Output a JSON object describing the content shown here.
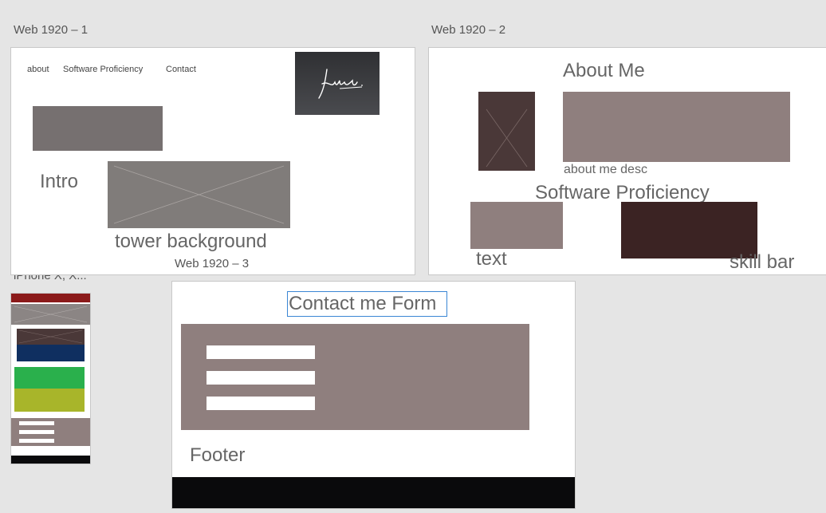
{
  "artboards": {
    "web1": {
      "title": "Web 1920 – 1",
      "nav": {
        "about": "about",
        "software": "Software Proficiency",
        "contact": "Contact"
      },
      "logo_text": "Julien .",
      "intro_label": "Intro",
      "tower_label": "tower background"
    },
    "web2": {
      "title": "Web 1920 – 2",
      "about_heading": "About Me",
      "about_desc_label": "about me desc",
      "software_heading": "Software Proficiency",
      "text_label": "text",
      "skill_label": "skill bar"
    },
    "web3": {
      "title": "Web 1920 – 3",
      "contact_heading": "Contact me Form",
      "footer_label": "Footer"
    },
    "iphone": {
      "title": "iPhone X, X..."
    }
  },
  "colors": {
    "canvas": "#e5e5e5",
    "muted_taupe": "#8f7f7e",
    "dark_brown": "#4a3838",
    "darker_brown": "#3b2323",
    "logo_bg": "#3a3b3e",
    "gray_block": "#767070",
    "placeholder_gray": "#807c7a",
    "mobile_red": "#8b1a1a",
    "mobile_navy": "#0f2f60",
    "mobile_green": "#2ab04c",
    "mobile_olive": "#a8b52a",
    "footer_black": "#0a0a0c",
    "selection_blue": "#3a86d4"
  },
  "icons": {
    "image_placeholder": "x-placeholder-icon",
    "signature_logo": "signature-logo-icon"
  }
}
